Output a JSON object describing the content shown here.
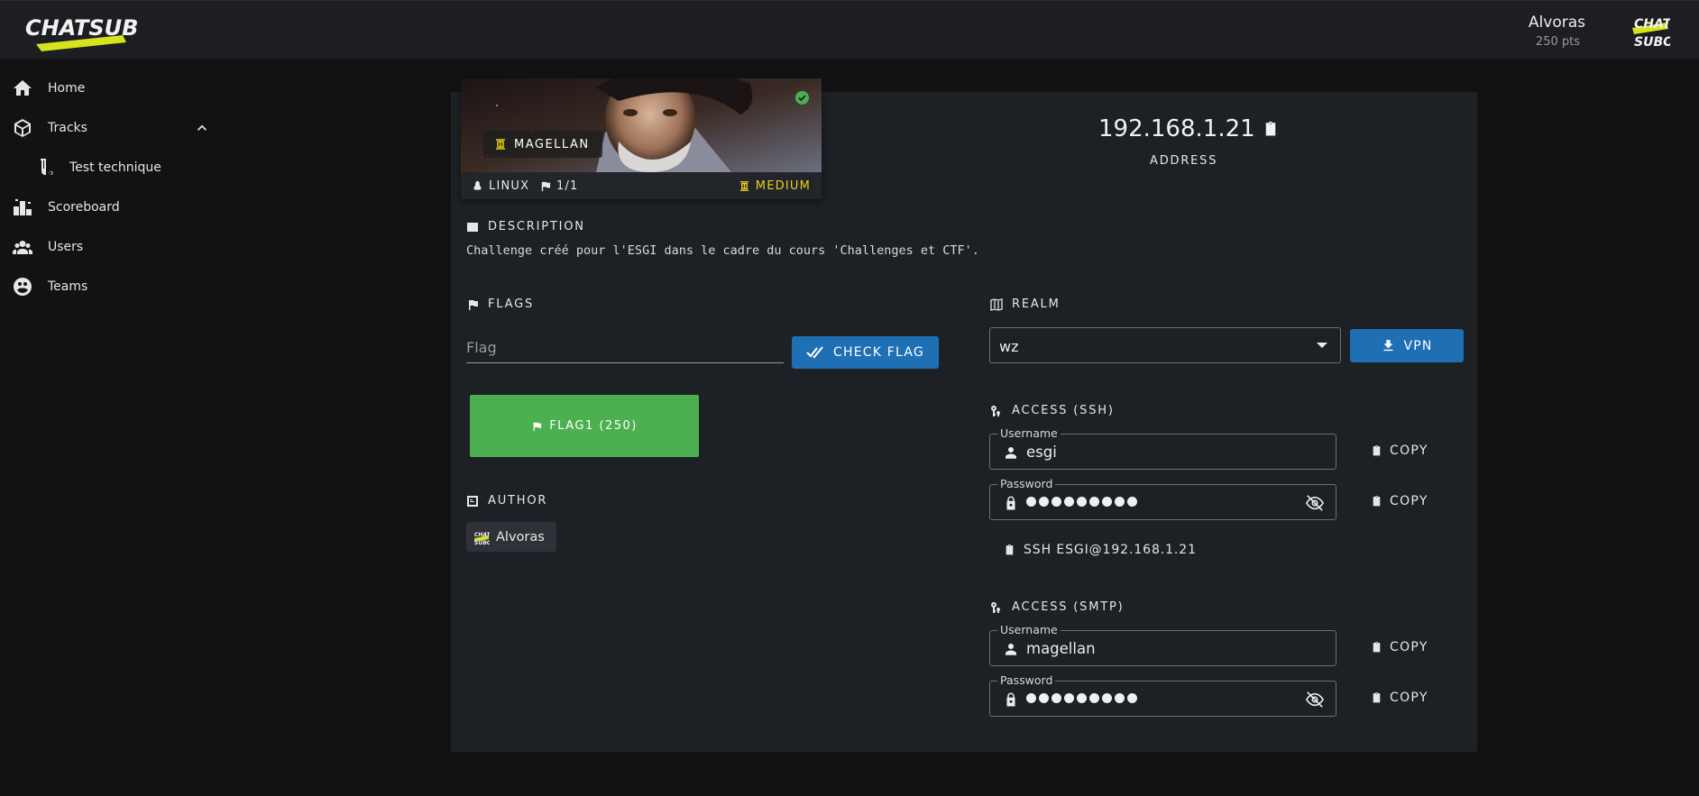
{
  "app": {
    "logo_text": "CHATSUBO",
    "user_logo_text": [
      "CHAT",
      "SUBO"
    ],
    "user_name": "Alvoras",
    "user_points": "250 pts"
  },
  "sidebar": {
    "items": [
      {
        "label": "Home",
        "icon": "home-icon"
      },
      {
        "label": "Tracks",
        "icon": "cube-icon",
        "expanded": true
      },
      {
        "label": "Test technique",
        "icon": "test-tube-icon"
      },
      {
        "label": "Scoreboard",
        "icon": "podium-icon"
      },
      {
        "label": "Users",
        "icon": "users-icon"
      },
      {
        "label": "Teams",
        "icon": "team-emblem-icon"
      }
    ]
  },
  "challenge": {
    "name": "MAGELLAN",
    "os": "LINUX",
    "flags_count": "1/1",
    "difficulty": "MEDIUM",
    "solved": true,
    "colors": {
      "difficulty": "#e8d11b",
      "solved": "#4caf50"
    }
  },
  "address": {
    "ip": "192.168.1.21",
    "label": "ADDRESS"
  },
  "description": {
    "title": "DESCRIPTION",
    "text": "Challenge créé pour l'ESGI dans le cadre du cours 'Challenges et CTF'."
  },
  "flags": {
    "title": "FLAGS",
    "input_placeholder": "Flag",
    "check_label": "CHECK FLAG",
    "found": [
      {
        "label": "FLAG1 (250)",
        "color": "#4caf50"
      }
    ]
  },
  "author": {
    "title": "AUTHOR",
    "name": "Alvoras"
  },
  "realm": {
    "title": "REALM",
    "selected": "wz",
    "vpn_label": "VPN"
  },
  "access_ssh": {
    "title": "ACCESS (SSH)",
    "username_label": "Username",
    "username": "esgi",
    "password_label": "Password",
    "password_masked_length": 9,
    "copy_label": "COPY",
    "command": "SSH ESGI@192.168.1.21"
  },
  "access_smtp": {
    "title": "ACCESS (SMTP)",
    "username_label": "Username",
    "username": "magellan",
    "password_label": "Password",
    "password_masked_length": 9,
    "copy_label": "COPY"
  },
  "colors": {
    "primary_button": "#1f6fb5",
    "success": "#4caf50",
    "background": "#121212",
    "card": "#1d2024"
  }
}
